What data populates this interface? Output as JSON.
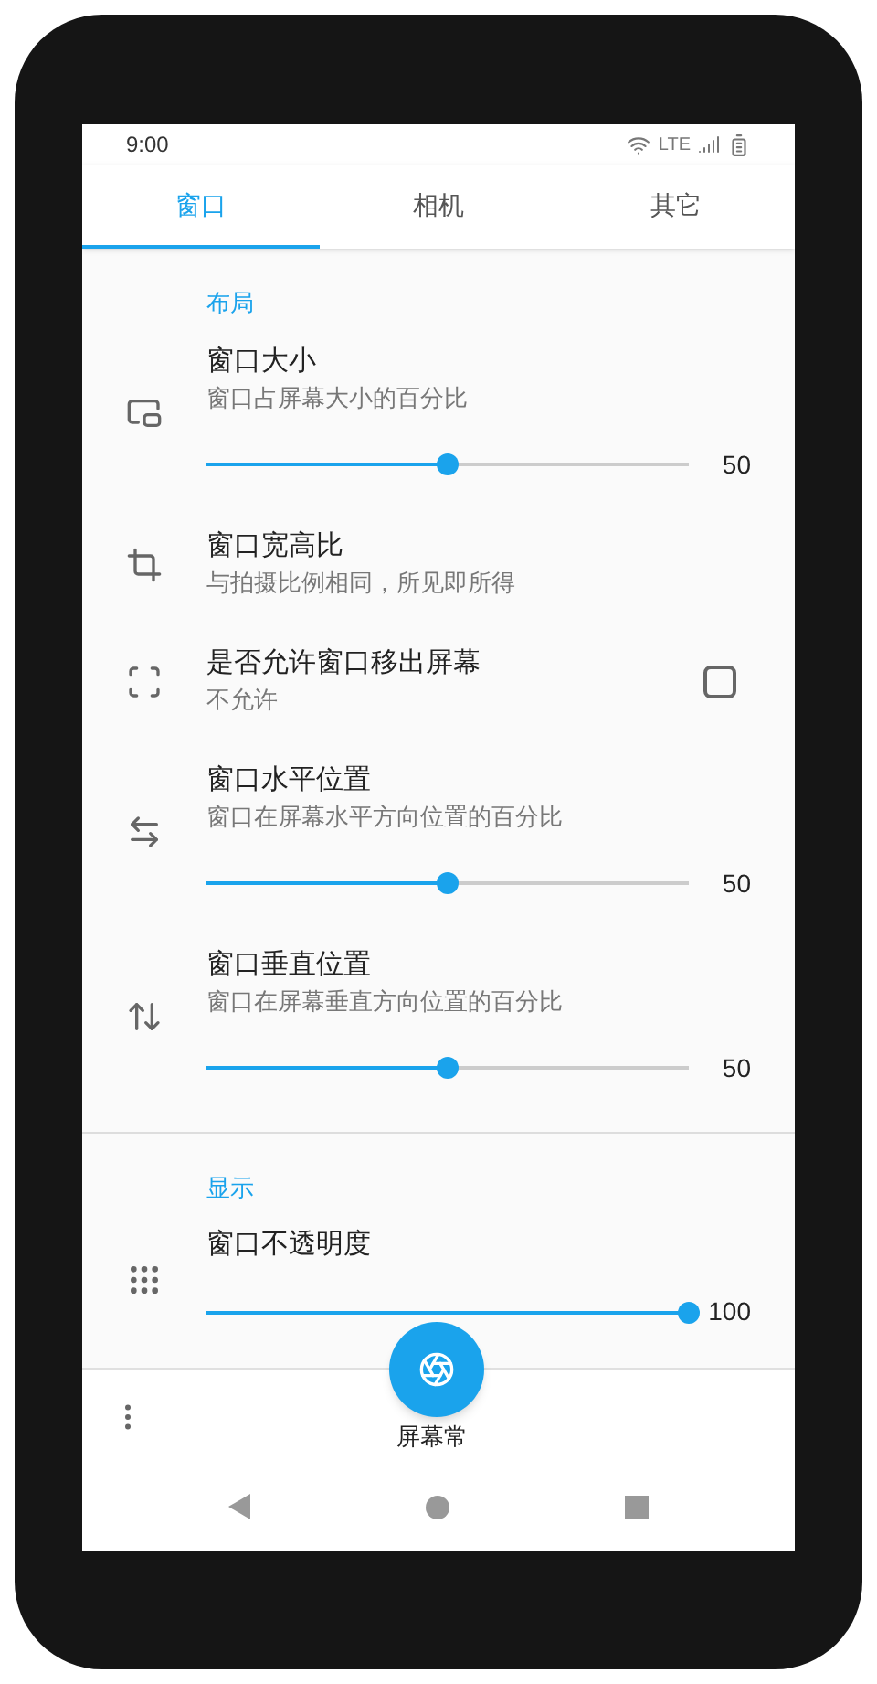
{
  "status_bar": {
    "time": "9:00",
    "network": "LTE"
  },
  "tabs": [
    {
      "label": "窗口",
      "selected": true
    },
    {
      "label": "相机",
      "selected": false
    },
    {
      "label": "其它",
      "selected": false
    }
  ],
  "sections": [
    {
      "title": "布局",
      "items": [
        {
          "kind": "slider",
          "title": "窗口大小",
          "subtitle": "窗口占屏幕大小的百分比",
          "level": 0.5,
          "reading": "50"
        },
        {
          "kind": "text",
          "title": "窗口宽高比",
          "subtitle": "与拍摄比例相同，所见即所得"
        },
        {
          "kind": "checkbox",
          "title": "是否允许窗口移出屏幕",
          "subtitle": "不允许",
          "checked": false
        },
        {
          "kind": "slider",
          "title": "窗口水平位置",
          "subtitle": "窗口在屏幕水平方向位置的百分比",
          "level": 0.5,
          "reading": "50"
        },
        {
          "kind": "slider",
          "title": "窗口垂直位置",
          "subtitle": "窗口在屏幕垂直方向位置的百分比",
          "level": 0.5,
          "reading": "50"
        }
      ]
    },
    {
      "title": "显示",
      "items": [
        {
          "kind": "slider",
          "title": "窗口不透明度",
          "level": 1,
          "reading": "100"
        }
      ]
    }
  ],
  "bottom_bar": {
    "label": "屏幕常"
  }
}
